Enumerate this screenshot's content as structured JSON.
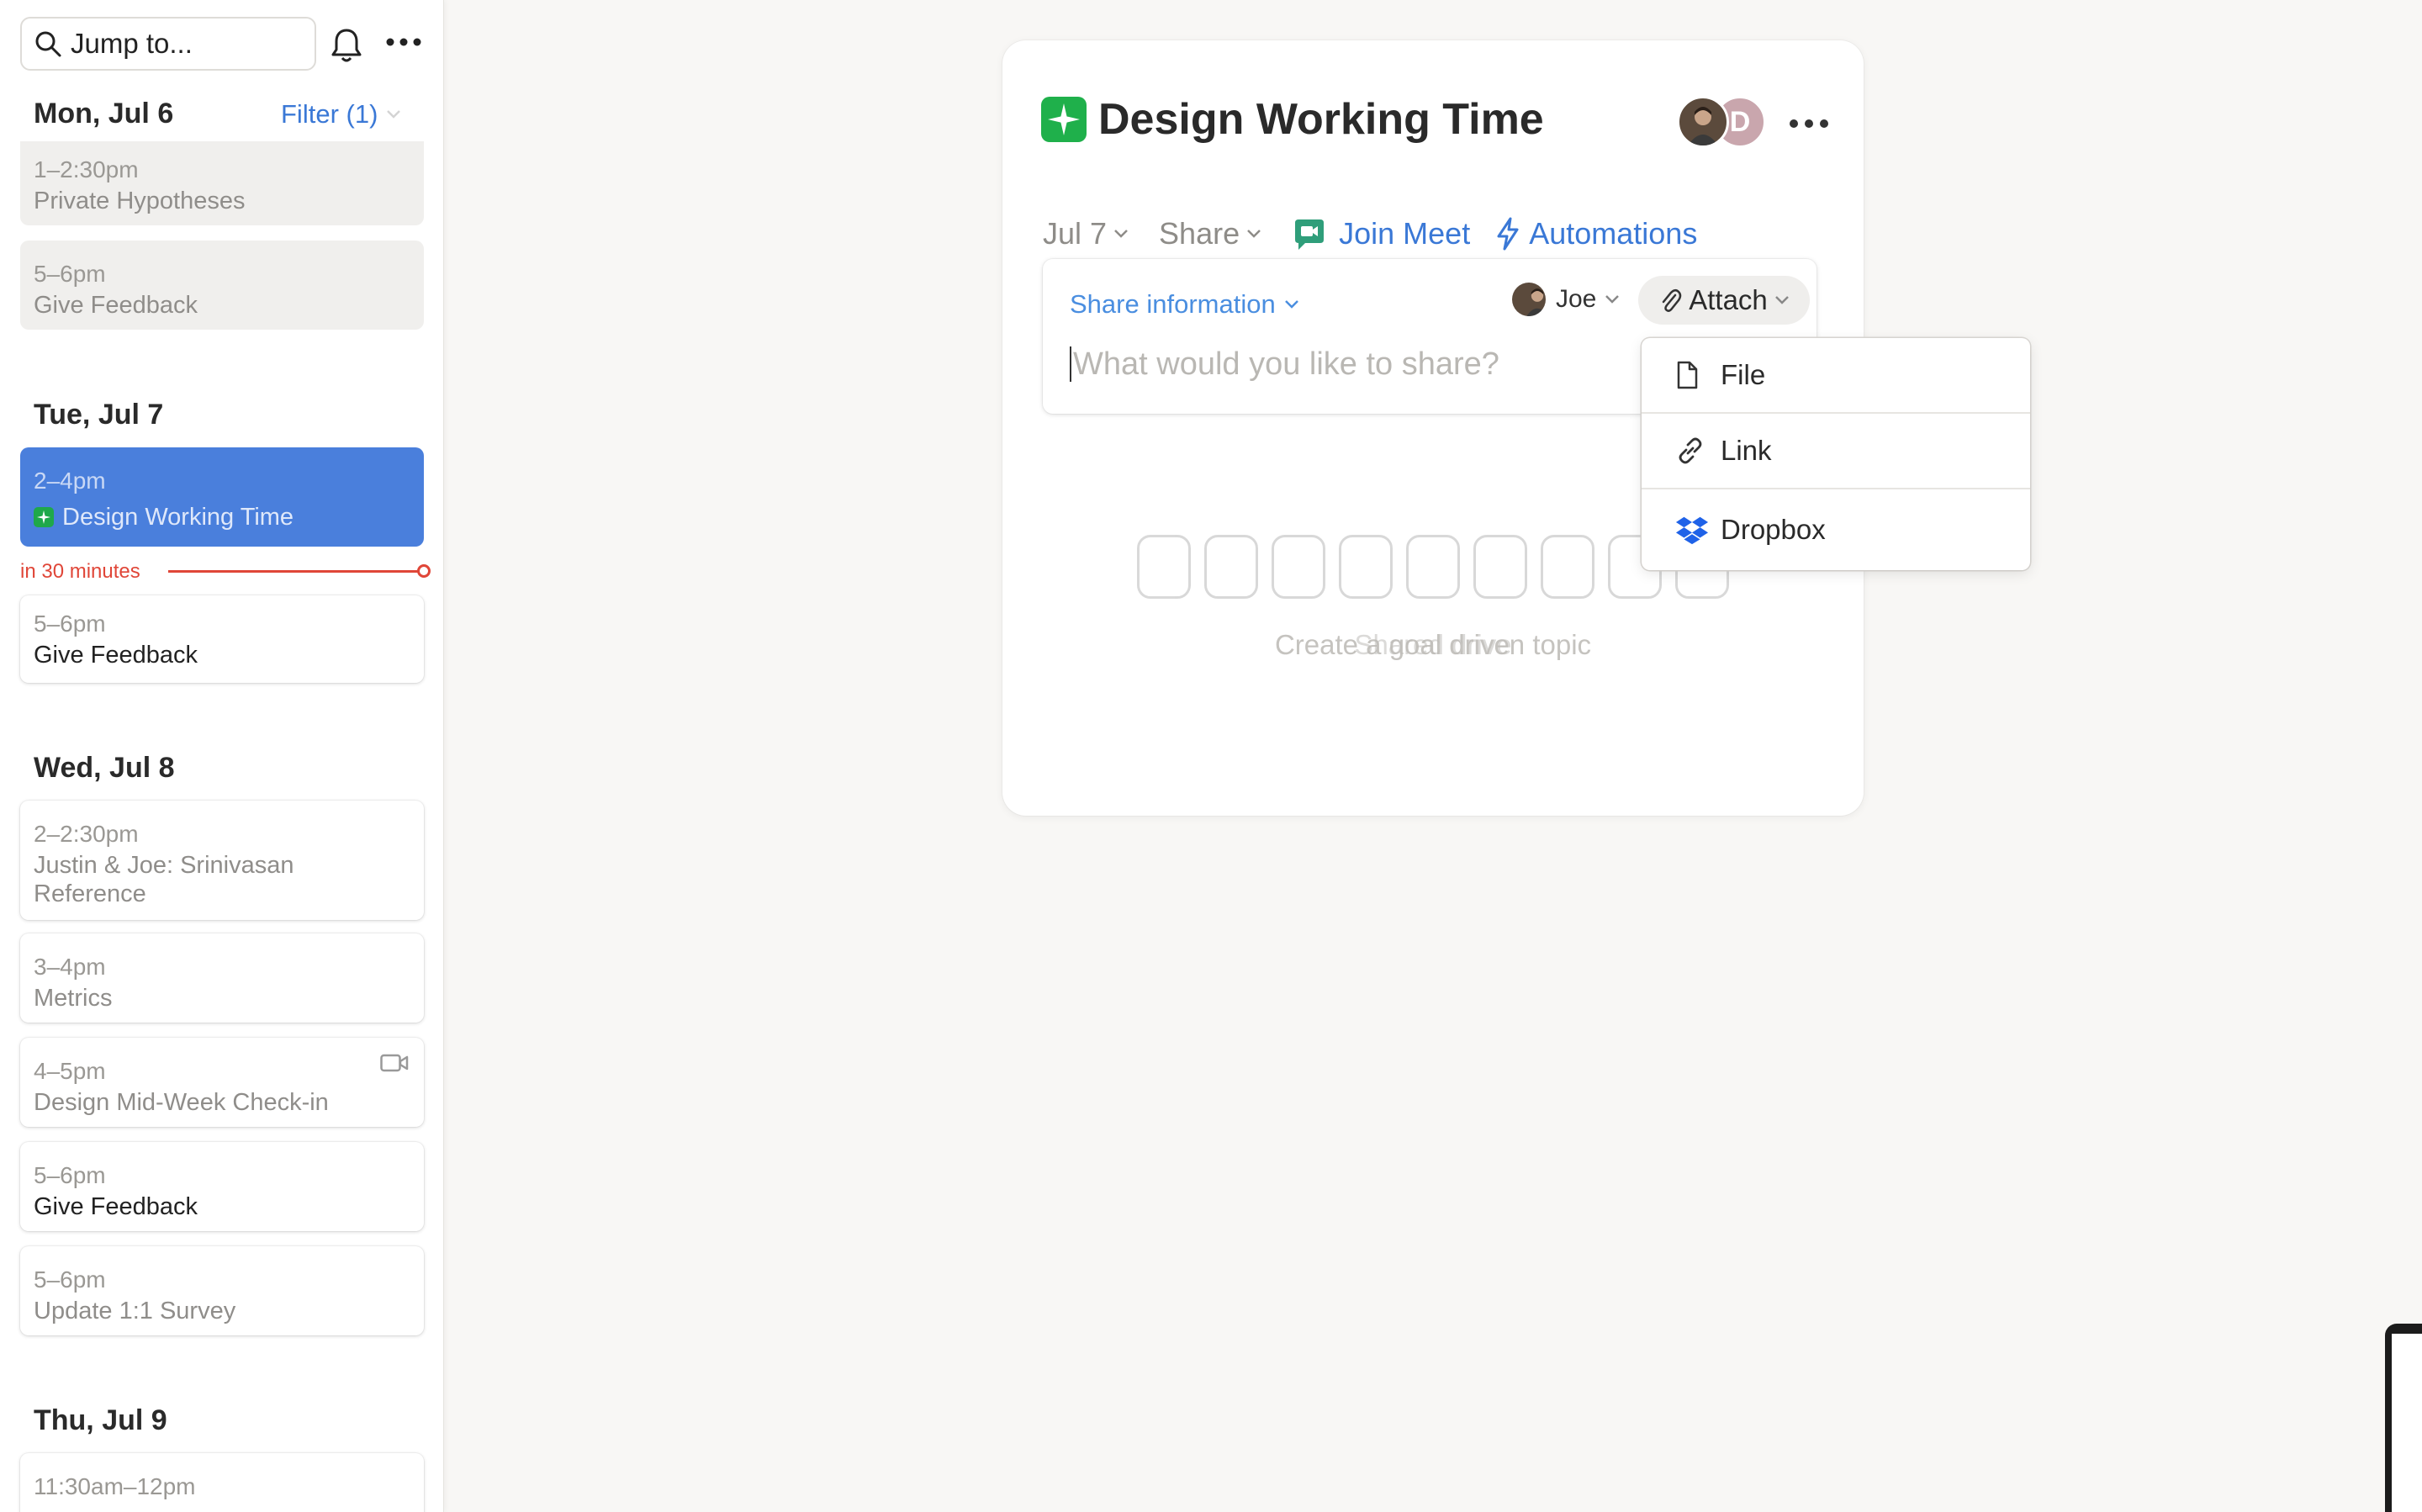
{
  "sidebar": {
    "search_placeholder": "Jump to...",
    "filter_label": "Filter (1)",
    "now_label": "in 30 minutes",
    "days": [
      {
        "label": "Mon, Jul 6",
        "events": [
          {
            "time": "1–2:30pm",
            "title": "Private Hypotheses"
          },
          {
            "time": "5–6pm",
            "title": "Give Feedback"
          }
        ]
      },
      {
        "label": "Tue, Jul 7",
        "events": [
          {
            "time": "2–4pm",
            "title": "Design Working Time"
          },
          {
            "time": "5–6pm",
            "title": "Give Feedback"
          }
        ]
      },
      {
        "label": "Wed, Jul 8",
        "events": [
          {
            "time": "2–2:30pm",
            "title_line1": "Justin & Joe: Srinivasan",
            "title_line2": "Reference"
          },
          {
            "time": "3–4pm",
            "title": "Metrics"
          },
          {
            "time": "4–5pm",
            "title": "Design Mid-Week Check-in"
          },
          {
            "time": "5–6pm",
            "title": "Give Feedback"
          },
          {
            "time": "5–6pm",
            "title": "Update 1:1 Survey"
          }
        ]
      },
      {
        "label": "Thu, Jul 9",
        "events": [
          {
            "time": "11:30am–12pm"
          }
        ]
      }
    ]
  },
  "panel": {
    "title": "Design Working Time",
    "avatar_initial": "D",
    "date_label": "Jul 7",
    "share_label": "Share",
    "join_meet_label": "Join Meet",
    "automations_label": "Automations",
    "share_info_label": "Share information",
    "author_label": "Joe",
    "attach_label": "Attach",
    "input_placeholder": "What would you like to share?",
    "hint_text": "Create a goal driven topic",
    "hint_overlay_text": "Shared drive"
  },
  "attach_menu": {
    "items": [
      {
        "label": "File",
        "icon": "file-icon"
      },
      {
        "label": "Link",
        "icon": "link-icon"
      },
      {
        "label": "Dropbox",
        "icon": "dropbox-icon"
      }
    ]
  },
  "colors": {
    "accent": "#3a78d6",
    "active_event": "#4a7fdc",
    "now_indicator": "#e04638",
    "spark_green": "#1fb04b"
  }
}
